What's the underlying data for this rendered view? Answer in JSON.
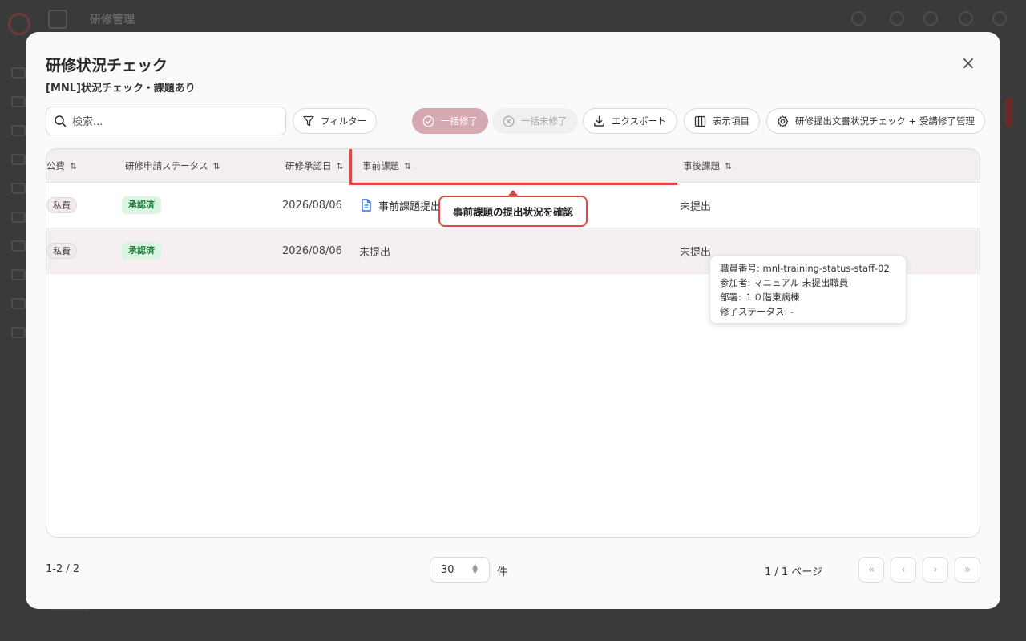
{
  "modal": {
    "title": "研修状況チェック",
    "subtitle": "[MNL]状況チェック・課題あり",
    "close_label": "×"
  },
  "toolbar": {
    "search_placeholder": "検索...",
    "filter_label": "フィルター",
    "bulk_complete_label": "一括修了",
    "bulk_incomplete_label": "一括未修了",
    "export_label": "エクスポート",
    "columns_label": "表示項目",
    "manage_label": "研修提出文書状況チェック + 受講修了管理"
  },
  "table": {
    "headers": {
      "public_fee": "公費",
      "application_status": "研修申請ステータス",
      "approval_date": "研修承認日",
      "pre_assignment": "事前課題",
      "post_assignment": "事後課題"
    },
    "sort_glyph": "⇅",
    "rows": [
      {
        "fee": "私費",
        "status": "承認済",
        "approval_date": "2026/08/06",
        "pre_assignment": "事前課題提出",
        "post_assignment": "未提出"
      },
      {
        "fee": "私費",
        "status": "承認済",
        "approval_date": "2026/08/06",
        "pre_assignment": "未提出",
        "post_assignment": "未提出"
      }
    ]
  },
  "callout": {
    "text": "事前課題の提出状況を確認"
  },
  "tooltip": {
    "staff_number": "職員番号: mnl-training-status-staff-02",
    "participant": "参加者: マニュアル 未提出職員",
    "department": "部署: １０階東病棟",
    "completion_status": "修了ステータス: -"
  },
  "pagination": {
    "range": "1-2 / 2",
    "page_size": "30",
    "unit": "件",
    "page_info": "1 / 1 ページ",
    "first": "«",
    "prev": "‹",
    "next": "›",
    "last": "»"
  },
  "colors": {
    "accent": "#e04848",
    "primary_disabled": "#d6a8b2",
    "header_bg": "#f5eef0",
    "badge_green_bg": "#dcf5e3",
    "badge_green_text": "#1e7a3c"
  },
  "icons": {
    "search": "search-icon",
    "filter": "filter-icon",
    "check_circle": "check-circle-icon",
    "x_circle": "x-circle-icon",
    "download": "download-icon",
    "columns": "columns-icon",
    "gear": "gear-icon",
    "document": "document-icon"
  }
}
